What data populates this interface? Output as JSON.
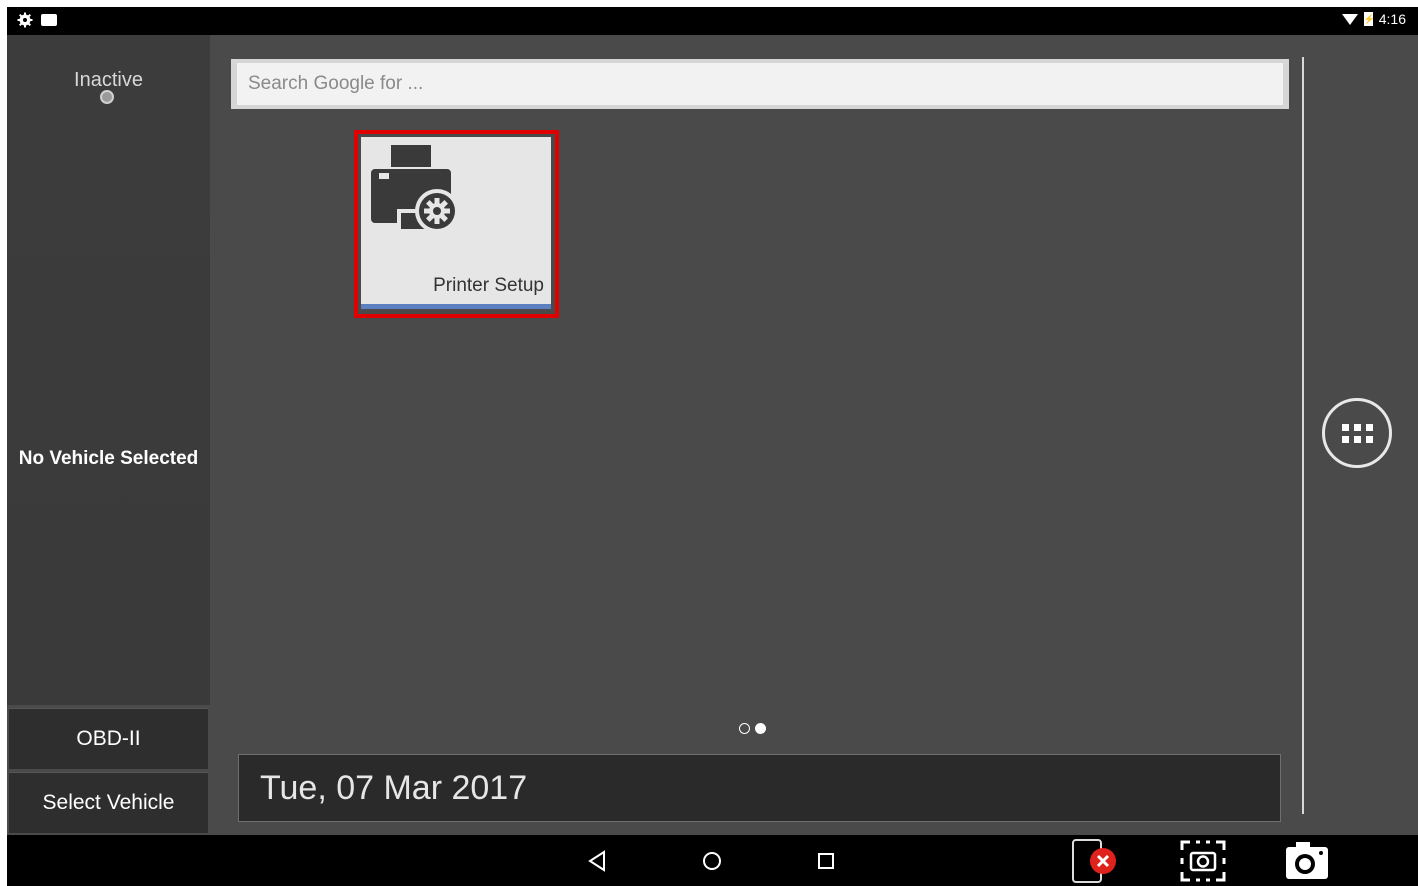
{
  "status_bar": {
    "time": "4:16"
  },
  "left_panel": {
    "connection_status": "Inactive",
    "vehicle_status": "No Vehicle Selected",
    "buttons": {
      "obd": "OBD-II",
      "select_vehicle": "Select Vehicle"
    }
  },
  "search": {
    "placeholder": "Search Google for ..."
  },
  "tiles": [
    {
      "label": "Printer Setup"
    }
  ],
  "pager": {
    "pages": 2,
    "current": 2
  },
  "date": "Tue, 07 Mar 2017",
  "colors": {
    "highlight": "#e00000",
    "tile_accent": "#5b7fc0"
  }
}
